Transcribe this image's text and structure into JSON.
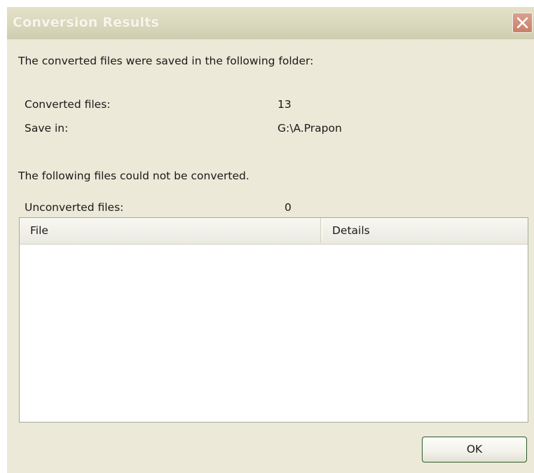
{
  "window": {
    "title": "Conversion Results"
  },
  "summary": {
    "saved_message": "The converted files were saved in the following folder:",
    "converted_files_label": "Converted files:",
    "converted_files_value": "13",
    "save_in_label": "Save in:",
    "save_in_value": "G:\\A.Prapon"
  },
  "unconverted": {
    "message": "The following files could not be converted.",
    "count_label": "Unconverted files:",
    "count_value": "0",
    "columns": [
      "File",
      "Details"
    ],
    "rows": []
  },
  "buttons": {
    "ok_label": "OK"
  },
  "colors": {
    "window_bg": "#ece9d8",
    "titlebar_bg": "#d9d8bc",
    "close_button_bg": "#c87f69",
    "ok_button_border": "#2b5b25"
  },
  "icons": {
    "close": "close-icon"
  }
}
